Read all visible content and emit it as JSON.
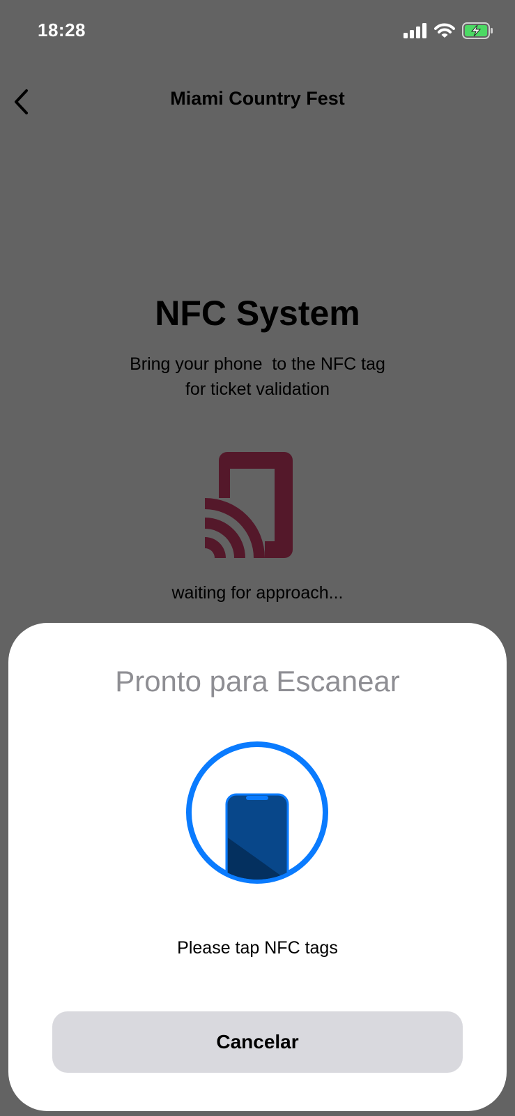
{
  "status_bar": {
    "time": "18:28",
    "icons": [
      "cellular-signal-icon",
      "wifi-icon",
      "battery-charging-icon"
    ]
  },
  "nav": {
    "back_icon": "chevron-left-icon",
    "title": "Miami Country Fest"
  },
  "main": {
    "heading": "NFC System",
    "subtitle_line1": "Bring your phone  to the NFC tag",
    "subtitle_line2": "for ticket validation",
    "illustration_icon": "phone-nfc-icon",
    "status_text": "waiting for approach..."
  },
  "scan_sheet": {
    "title": "Pronto para Escanear",
    "illustration_icon": "phone-scan-icon",
    "hint": "Please tap NFC tags",
    "cancel_label": "Cancelar"
  },
  "colors": {
    "dim_background": "#636363",
    "nfc_icon": "#54182a",
    "scan_ring": "#0a7bfe",
    "phone_body": "#08478a",
    "cancel_button": "#d9d9de",
    "sheet_title": "#8e8e93",
    "battery_fill": "#4cd964"
  }
}
